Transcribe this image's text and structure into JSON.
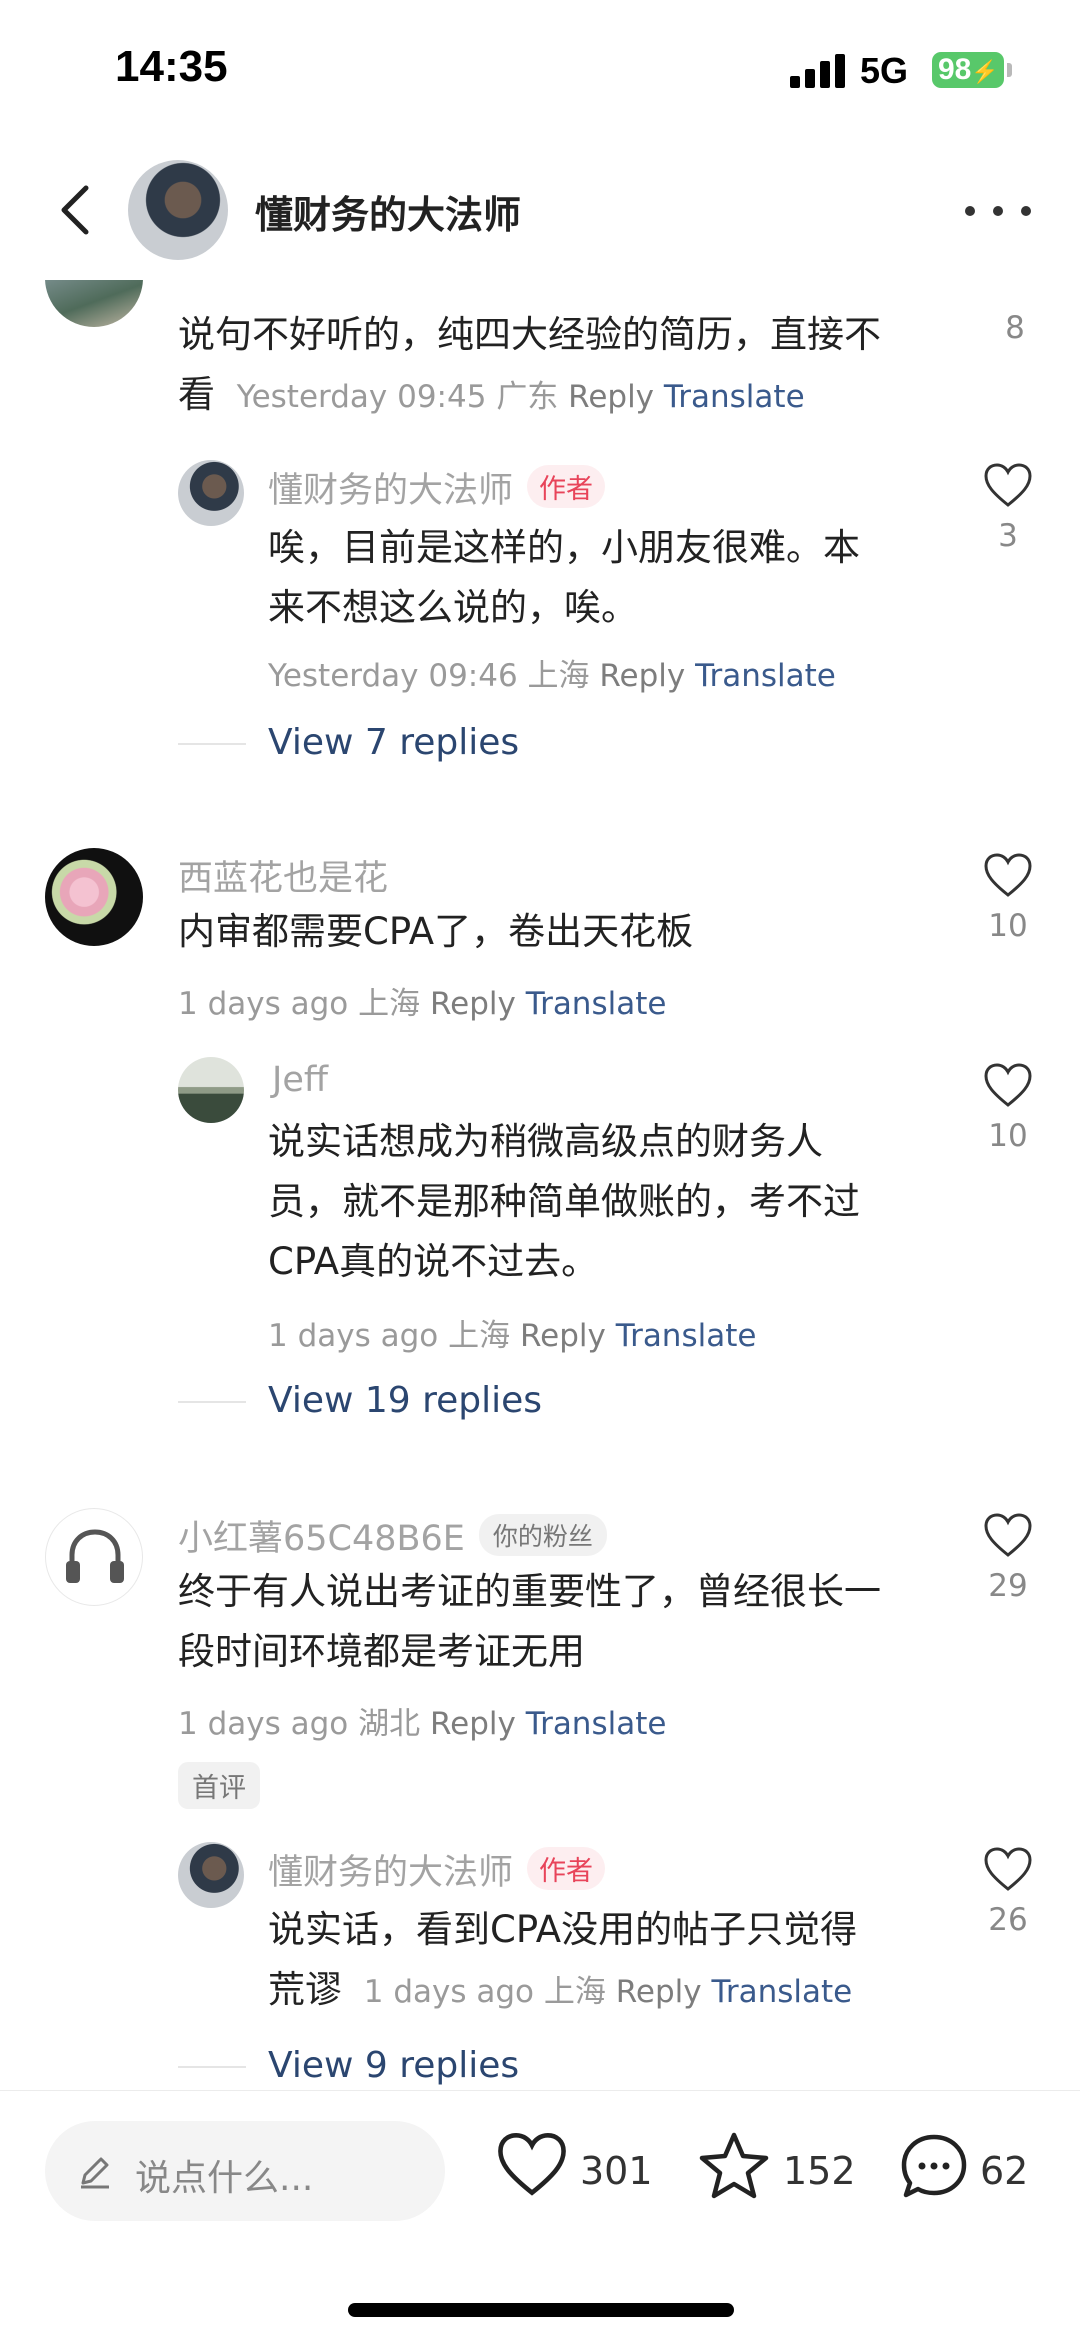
{
  "status_bar": {
    "time": "14:35",
    "network": "5G",
    "battery": "98"
  },
  "header": {
    "title": "懂财务的大法师"
  },
  "comments": [
    {
      "text": "说句不好听的，纯四大经验的简历，直接不看",
      "text_line1": "说句不好听的，纯四大经验的简历，直接不",
      "text_line2": "看",
      "time": "Yesterday 09:45",
      "location": "广东",
      "reply": "Reply",
      "translate": "Translate",
      "likes": "8",
      "sub": {
        "name": "懂财务的大法师",
        "badge": "作者",
        "text_line1": "唉，目前是这样的，小朋友很难。本",
        "text_line2": "来不想这么说的，唉。",
        "time": "Yesterday 09:46",
        "location": "上海",
        "reply": "Reply",
        "translate": "Translate",
        "likes": "3"
      },
      "view_replies": "View 7 replies"
    },
    {
      "name": "西蓝花也是花",
      "text": "内审都需要CPA了，卷出天花板",
      "time": "1 days ago",
      "location": "上海",
      "reply": "Reply",
      "translate": "Translate",
      "likes": "10",
      "sub": {
        "name": "Jeff",
        "text_line1": "说实话想成为稍微高级点的财务人",
        "text_line2": "员，就不是那种简单做账的，考不过",
        "text_line3": "CPA真的说不过去。",
        "time": "1 days ago",
        "location": "上海",
        "reply": "Reply",
        "translate": "Translate",
        "likes": "10"
      },
      "view_replies": "View 19 replies"
    },
    {
      "name": "小红薯65C48B6E",
      "badge": "你的粉丝",
      "text_line1": "终于有人说出考证的重要性了，曾经很长一",
      "text_line2": "段时间环境都是考证无用",
      "time": "1 days ago",
      "location": "湖北",
      "reply": "Reply",
      "translate": "Translate",
      "likes": "29",
      "tag": "首评",
      "sub": {
        "name": "懂财务的大法师",
        "badge": "作者",
        "text_line1": "说实话，看到CPA没用的帖子只觉得",
        "text_line2": "荒谬",
        "time": "1 days ago",
        "location": "上海",
        "reply": "Reply",
        "translate": "Translate",
        "likes": "26"
      },
      "view_replies": "View 9 replies"
    }
  ],
  "bottom_bar": {
    "placeholder": "说点什么...",
    "likes": "301",
    "stars": "152",
    "comments": "62"
  },
  "colors": {
    "accent_link": "#2b4670",
    "author_badge": "#e8445a",
    "battery": "#58c86a"
  }
}
